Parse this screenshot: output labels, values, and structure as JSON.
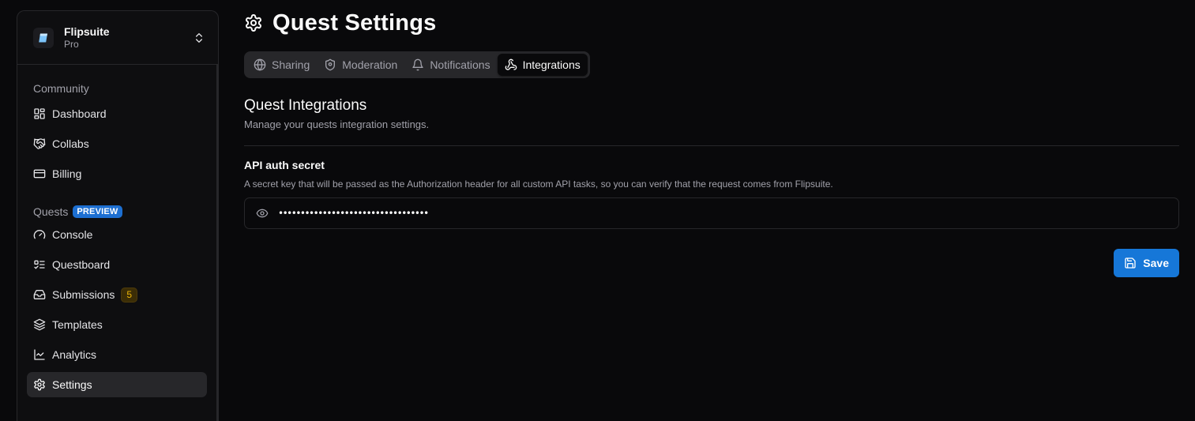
{
  "workspace": {
    "name": "Flipsuite",
    "plan": "Pro"
  },
  "sidebar": {
    "groups": [
      {
        "label": "Community",
        "items": [
          {
            "label": "Dashboard",
            "icon": "dashboard-icon"
          },
          {
            "label": "Collabs",
            "icon": "handshake-icon"
          },
          {
            "label": "Billing",
            "icon": "credit-card-icon"
          }
        ]
      },
      {
        "label": "Quests",
        "badge": "PREVIEW",
        "items": [
          {
            "label": "Console",
            "icon": "gauge-icon"
          },
          {
            "label": "Questboard",
            "icon": "list-todo-icon"
          },
          {
            "label": "Submissions",
            "icon": "inbox-icon",
            "count": "5"
          },
          {
            "label": "Templates",
            "icon": "layers-icon"
          },
          {
            "label": "Analytics",
            "icon": "line-chart-icon"
          },
          {
            "label": "Settings",
            "icon": "gear-icon",
            "active": true
          }
        ]
      }
    ]
  },
  "page": {
    "title": "Quest Settings"
  },
  "tabs": [
    {
      "label": "Sharing",
      "icon": "globe-icon"
    },
    {
      "label": "Moderation",
      "icon": "shield-icon"
    },
    {
      "label": "Notifications",
      "icon": "bell-icon"
    },
    {
      "label": "Integrations",
      "icon": "webhook-icon",
      "active": true
    }
  ],
  "section": {
    "title": "Quest Integrations",
    "subtitle": "Manage your quests integration settings."
  },
  "field": {
    "label": "API auth secret",
    "description": "A secret key that will be passed as the Authorization header for all custom API tasks, so you can verify that the request comes from Flipsuite.",
    "value": "••••••••••••••••••••••••••••••••••"
  },
  "actions": {
    "save_label": "Save"
  },
  "colors": {
    "accent": "#1677d8",
    "badge_preview": "#1d6fd1",
    "badge_count": "#eab308"
  }
}
